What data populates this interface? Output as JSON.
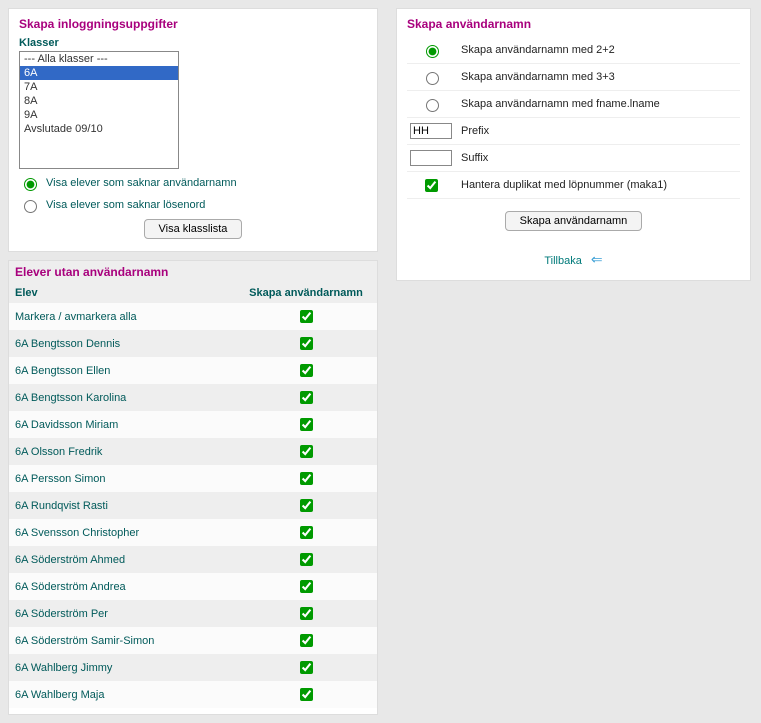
{
  "left": {
    "login_title": "Skapa inloggningsuppgifter",
    "classes_label": "Klasser",
    "class_options": [
      {
        "label": "--- Alla klasser ---",
        "selected": false
      },
      {
        "label": "6A",
        "selected": true
      },
      {
        "label": "7A",
        "selected": false
      },
      {
        "label": "8A",
        "selected": false
      },
      {
        "label": "9A",
        "selected": false
      },
      {
        "label": "Avslutade 09/10",
        "selected": false
      }
    ],
    "filter_radio": {
      "username_label": "Visa elever som saknar användarnamn",
      "password_label": "Visa elever som saknar lösenord",
      "selected": "username"
    },
    "show_classlist_btn": "Visa klasslista"
  },
  "students": {
    "title": "Elever utan användarnamn",
    "col_elev": "Elev",
    "col_create": "Skapa användarnamn",
    "rows": [
      {
        "name": "Markera / avmarkera alla",
        "checked": true
      },
      {
        "name": "6A Bengtsson Dennis",
        "checked": true
      },
      {
        "name": "6A Bengtsson Ellen",
        "checked": true
      },
      {
        "name": "6A Bengtsson Karolina",
        "checked": true
      },
      {
        "name": "6A Davidsson Miriam",
        "checked": true
      },
      {
        "name": "6A Olsson Fredrik",
        "checked": true
      },
      {
        "name": "6A Persson Simon",
        "checked": true
      },
      {
        "name": "6A Rundqvist Rasti",
        "checked": true
      },
      {
        "name": "6A Svensson Christopher",
        "checked": true
      },
      {
        "name": "6A Söderström Ahmed",
        "checked": true
      },
      {
        "name": "6A Söderström Andrea",
        "checked": true
      },
      {
        "name": "6A Söderström Per",
        "checked": true
      },
      {
        "name": "6A Söderström Samir-Simon",
        "checked": true
      },
      {
        "name": "6A Wahlberg Jimmy",
        "checked": true
      },
      {
        "name": "6A Wahlberg Maja",
        "checked": true
      }
    ]
  },
  "right": {
    "title": "Skapa användarnamn",
    "opt_2_2": "Skapa användarnamn med 2+2",
    "opt_3_3": "Skapa användarnamn med 3+3",
    "opt_fname": "Skapa användarnamn med fname.lname",
    "selected_scheme": "2_2",
    "prefix_label": "Prefix",
    "prefix_value": "HH",
    "suffix_label": "Suffix",
    "suffix_value": "",
    "duplicate_label": "Hantera duplikat med löpnummer (maka1)",
    "duplicate_checked": true,
    "create_btn": "Skapa användarnamn",
    "back_label": "Tillbaka"
  }
}
